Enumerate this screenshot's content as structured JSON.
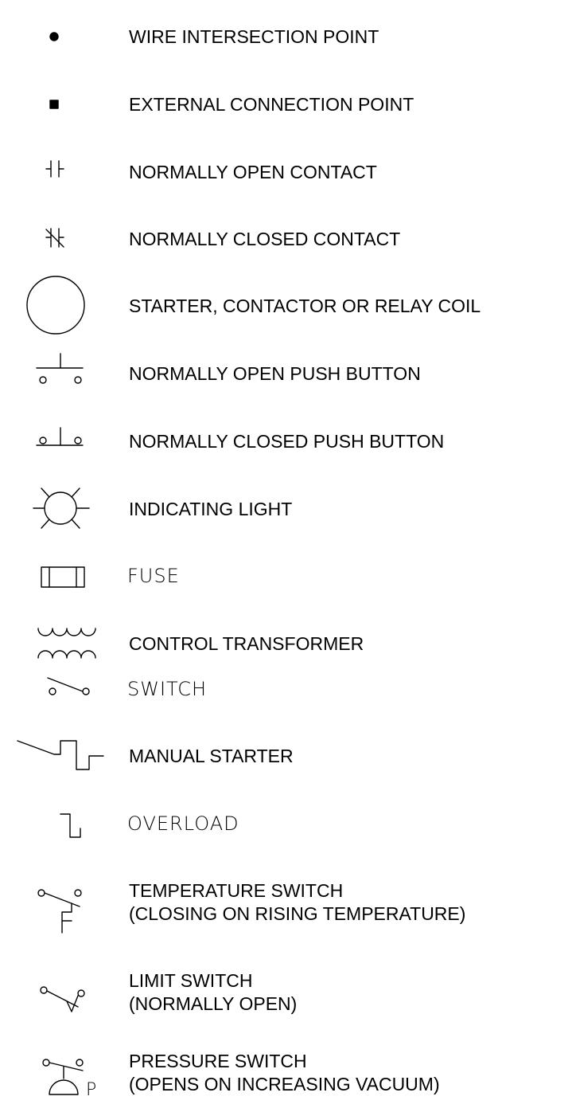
{
  "legend": {
    "items": [
      {
        "id": "wire-intersection",
        "icon": "wire-intersection-point-icon",
        "label": "WIRE INTERSECTION POINT"
      },
      {
        "id": "external-connection",
        "icon": "external-connection-point-icon",
        "label": "EXTERNAL CONNECTION POINT"
      },
      {
        "id": "no-contact",
        "icon": "normally-open-contact-icon",
        "label": "NORMALLY OPEN CONTACT"
      },
      {
        "id": "nc-contact",
        "icon": "normally-closed-contact-icon",
        "label": "NORMALLY CLOSED CONTACT"
      },
      {
        "id": "coil",
        "icon": "relay-coil-icon",
        "label": "STARTER, CONTACTOR OR RELAY COIL"
      },
      {
        "id": "no-push",
        "icon": "normally-open-push-button-icon",
        "label": "NORMALLY OPEN PUSH BUTTON"
      },
      {
        "id": "nc-push",
        "icon": "normally-closed-push-button-icon",
        "label": "NORMALLY CLOSED PUSH BUTTON"
      },
      {
        "id": "light",
        "icon": "indicating-light-icon",
        "label": "INDICATING LIGHT"
      },
      {
        "id": "fuse",
        "icon": "fuse-icon",
        "label": "FUSE"
      },
      {
        "id": "transformer",
        "icon": "control-transformer-icon",
        "label": "CONTROL TRANSFORMER"
      },
      {
        "id": "switch",
        "icon": "switch-icon",
        "label": "SWITCH"
      },
      {
        "id": "manual-starter",
        "icon": "manual-starter-icon",
        "label": "MANUAL STARTER"
      },
      {
        "id": "overload",
        "icon": "overload-icon",
        "label": "OVERLOAD"
      },
      {
        "id": "temp-switch",
        "icon": "temperature-switch-icon",
        "label": "TEMPERATURE SWITCH",
        "sublabel": "(CLOSING ON RISING TEMPERATURE)"
      },
      {
        "id": "limit-switch",
        "icon": "limit-switch-icon",
        "label": "LIMIT SWITCH",
        "sublabel": "(NORMALLY OPEN)"
      },
      {
        "id": "pressure-switch",
        "icon": "pressure-switch-icon",
        "label": "PRESSURE SWITCH",
        "sublabel": "(OPENS ON INCREASING VACUUM)",
        "symbol_text": "P"
      }
    ]
  }
}
